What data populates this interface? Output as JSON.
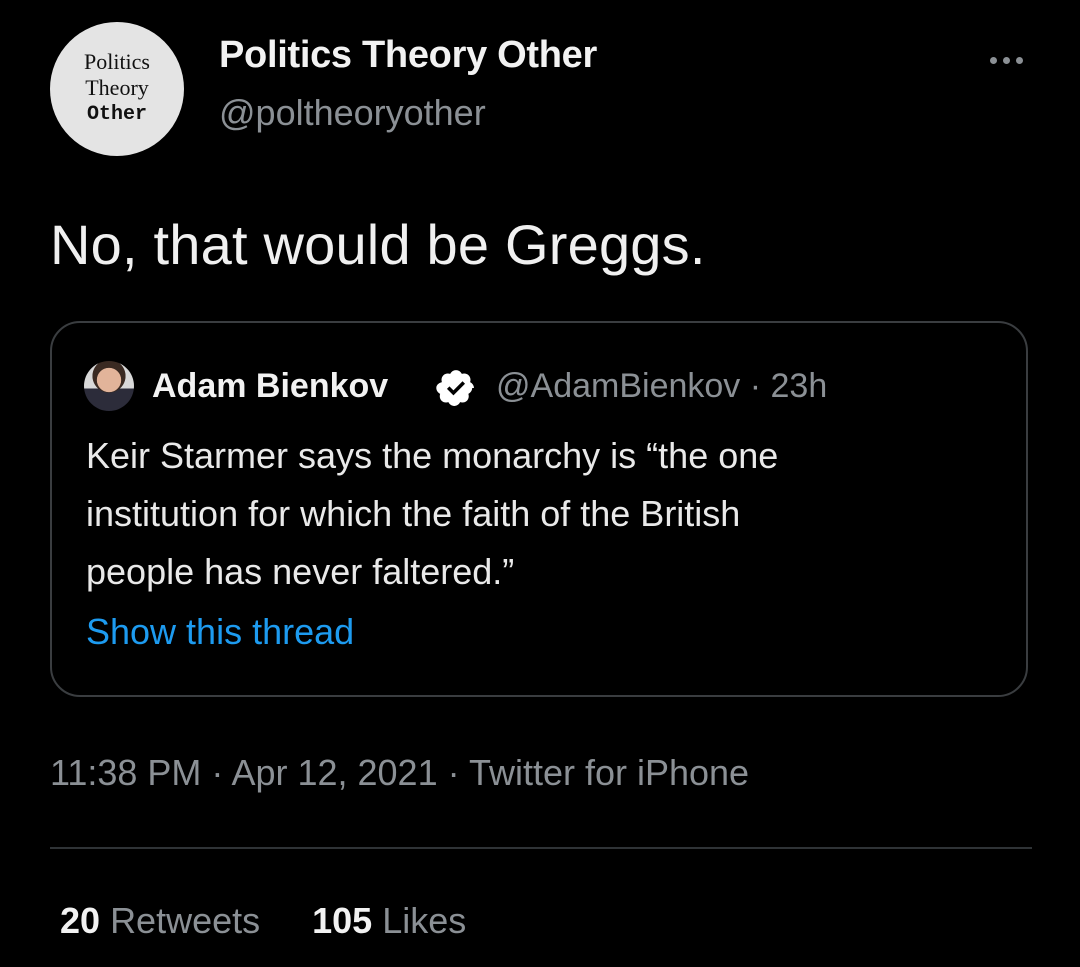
{
  "tweet": {
    "avatar_lines": [
      "Politics",
      "Theory",
      "Other"
    ],
    "display_name": "Politics Theory Other",
    "handle": "@poltheoryother",
    "text": "No, that would be Greggs.",
    "more_icon": "more-horizontal-icon"
  },
  "quote": {
    "author_name": "Adam Bienkov",
    "verified_icon": "verified-badge-icon",
    "handle_time": "@AdamBienkov · 23h",
    "body_lines": [
      "Keir Starmer says the monarchy is “the one",
      "institution for which the faith of the British",
      "people has never faltered.”"
    ],
    "show_thread": "Show this thread"
  },
  "meta": {
    "time": "11:38 PM",
    "sep1": " · ",
    "date": "Apr 12, 2021",
    "sep2": " · ",
    "source": "Twitter for iPhone"
  },
  "stats": {
    "retweets_count": "20",
    "retweets_label": "Retweets",
    "likes_count": "105",
    "likes_label": "Likes"
  },
  "colors": {
    "background": "#000000",
    "link": "#1d9bf0",
    "secondary_text": "#8b9095",
    "border": "#3a3d40"
  }
}
